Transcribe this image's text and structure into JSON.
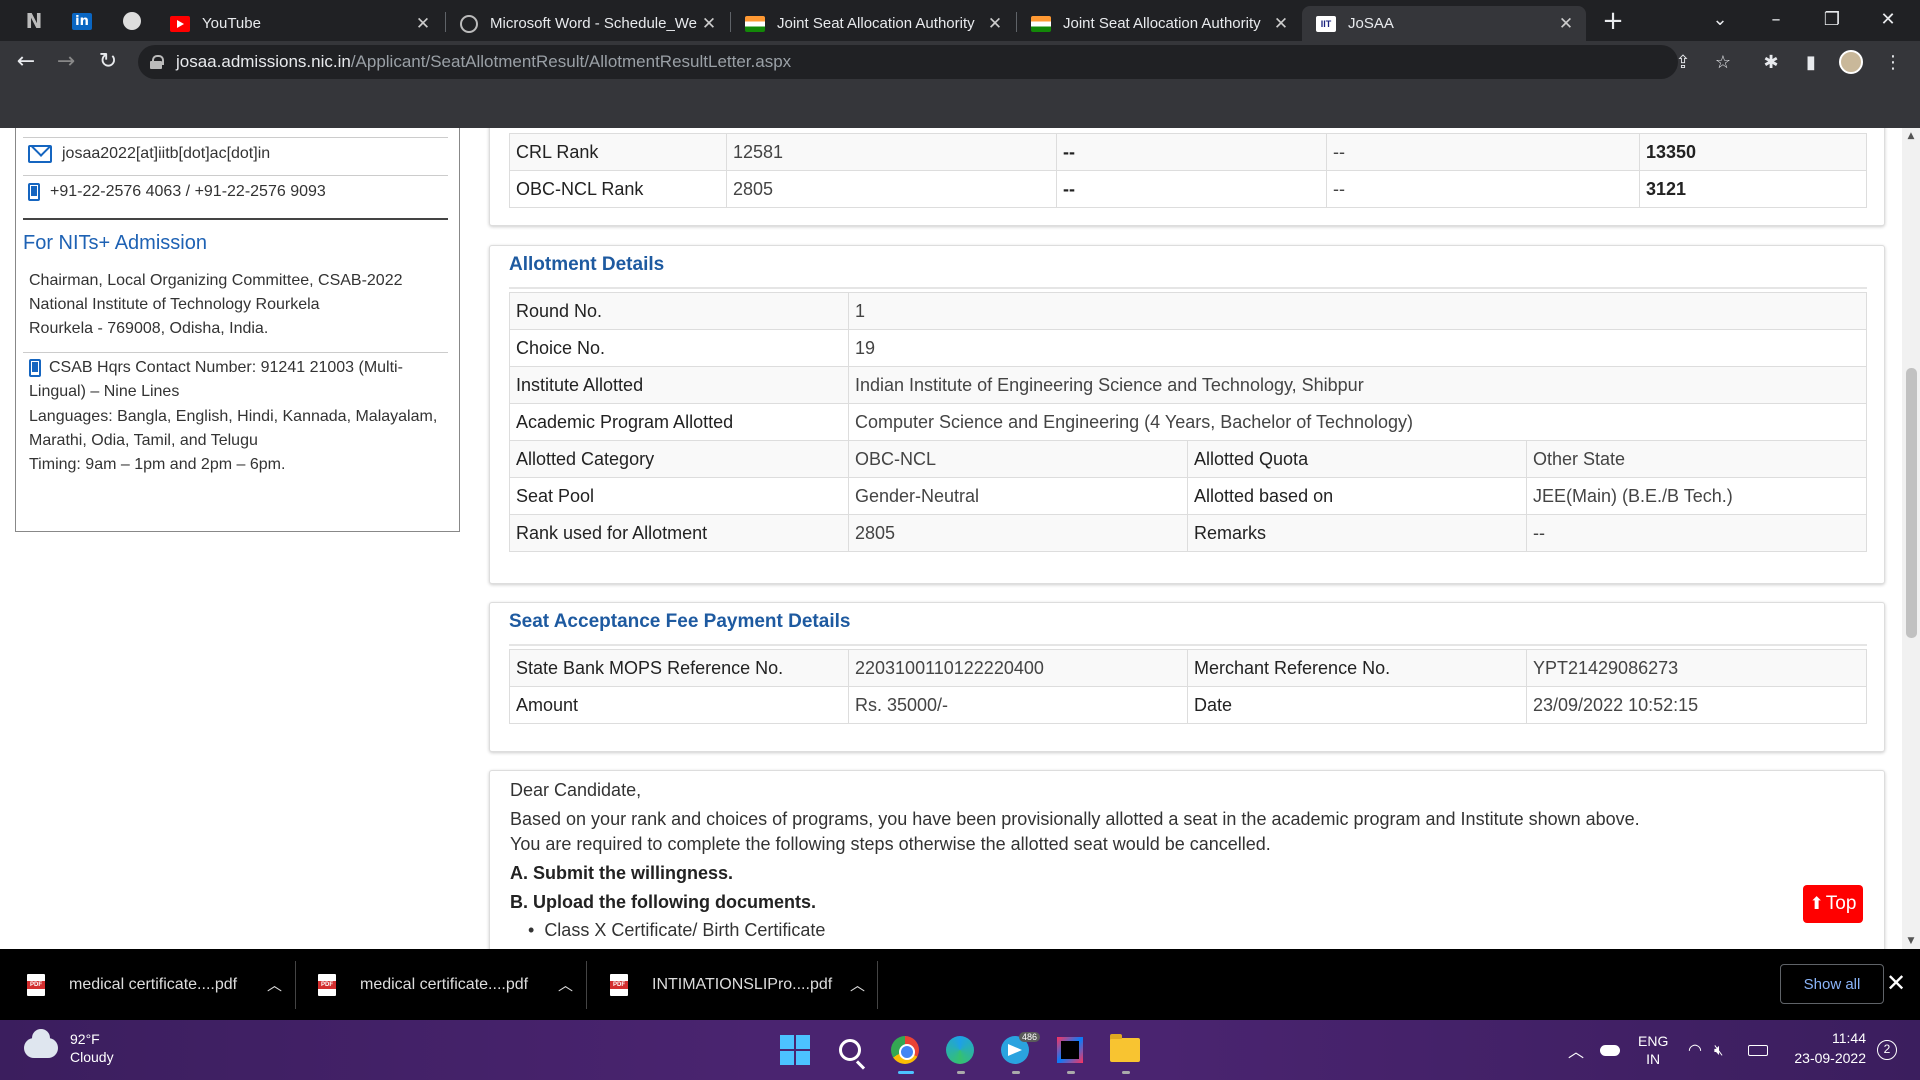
{
  "browser": {
    "tabs": [
      {
        "title": "YouTube",
        "icon": "youtube-icon"
      },
      {
        "title": "Microsoft Word - Schedule_We",
        "icon": "globe-icon"
      },
      {
        "title": "Joint Seat Allocation Authority",
        "icon": "india-flag-icon"
      },
      {
        "title": "Joint Seat Allocation Authority",
        "icon": "india-flag-icon"
      },
      {
        "title": "JoSAA",
        "icon": "josaa-logo-icon"
      }
    ],
    "url_host": "josaa.admissions.nic.in",
    "url_path": "/Applicant/SeatAllotmentResult/AllotmentResultLetter.aspx"
  },
  "sidebar": {
    "email": "josaa2022[at]iitb[dot]ac[dot]in",
    "phone": "+91-22-2576 4063 / +91-22-2576 9093",
    "nits_heading": "For NITs+ Admission",
    "address_lines": [
      "Chairman, Local Organizing Committee, CSAB-2022",
      "National Institute of Technology Rourkela",
      "Rourkela - 769008, Odisha, India."
    ],
    "contact_lines": [
      "CSAB Hqrs Contact Number: 91241 21003 (Multi-",
      "Lingual) – Nine Lines",
      "Languages: Bangla, English, Hindi, Kannada, Malayalam,",
      "Marathi, Odia, Tamil, and Telugu",
      "Timing: 9am – 1pm and 2pm – 6pm."
    ]
  },
  "ranks": [
    {
      "label": "CRL Rank",
      "c1": "12581",
      "c2": "--",
      "c3": "--",
      "c4": "13350"
    },
    {
      "label": "OBC-NCL Rank",
      "c1": "2805",
      "c2": "--",
      "c3": "--",
      "c4": "3121"
    }
  ],
  "allotment": {
    "title": "Allotment Details",
    "round_label": "Round No.",
    "round_value": "1",
    "choice_label": "Choice No.",
    "choice_value": "19",
    "institute_label": "Institute Allotted",
    "institute_value": "Indian Institute of Engineering Science and Technology, Shibpur",
    "program_label": "Academic Program Allotted",
    "program_value": "Computer Science and Engineering (4 Years, Bachelor of Technology)",
    "category_label": "Allotted Category",
    "category_value": "OBC-NCL",
    "quota_label": "Allotted Quota",
    "quota_value": "Other State",
    "pool_label": "Seat Pool",
    "pool_value": "Gender-Neutral",
    "basis_label": "Allotted based on",
    "basis_value": "JEE(Main) (B.E./B Tech.)",
    "rank_label": "Rank used for Allotment",
    "rank_value": "2805",
    "remarks_label": "Remarks",
    "remarks_value": "--"
  },
  "payment": {
    "title": "Seat Acceptance Fee Payment Details",
    "mops_label": "State Bank MOPS Reference No.",
    "mops_value": "2203100110122220400",
    "merchant_label": "Merchant Reference No.",
    "merchant_value": "YPT21429086273",
    "amount_label": "Amount",
    "amount_value": "Rs. 35000/-",
    "date_label": "Date",
    "date_value": "23/09/2022 10:52:15"
  },
  "letter": {
    "greeting": "Dear Candidate,",
    "line1": "Based on your rank and choices of programs, you have been provisionally allotted a seat in the academic program and Institute shown above.",
    "line2": "You are required to complete the following steps otherwise the allotted seat would be cancelled.",
    "step_a": "A. Submit the willingness.",
    "step_b": "B. Upload the following documents.",
    "doc1": "Class X Certificate/ Birth Certificate"
  },
  "top_button": "Top",
  "downloads": {
    "items": [
      "medical certificate....pdf",
      "medical certificate....pdf",
      "INTIMATIONSLIPro....pdf"
    ],
    "show_all": "Show all"
  },
  "taskbar": {
    "temperature": "92°F",
    "weather": "Cloudy",
    "telegram_badge": "486",
    "lang1": "ENG",
    "lang2": "IN",
    "time": "11:44",
    "date": "23-09-2022",
    "notifications": "2"
  }
}
